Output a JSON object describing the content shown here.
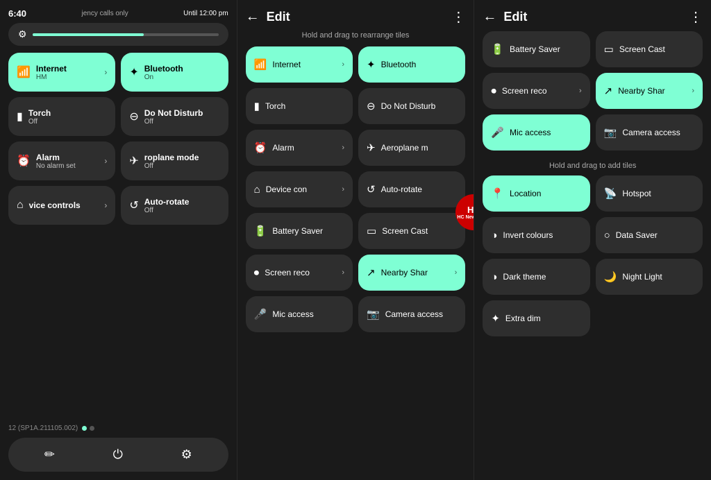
{
  "panel1": {
    "statusBar": {
      "time": "6:40",
      "info": "jency calls only",
      "right": "Until 12:00 pm"
    },
    "brightness": {
      "fill": 60
    },
    "tiles": [
      {
        "id": "internet",
        "label": "Internet",
        "sub": "HM",
        "icon": "📶",
        "active": true,
        "chevron": true
      },
      {
        "id": "bluetooth",
        "label": "Bluetooth",
        "sub": "On",
        "icon": "🔵",
        "active": true,
        "chevron": false
      },
      {
        "id": "torch",
        "label": "Torch",
        "sub": "Off",
        "icon": "🔦",
        "active": false,
        "chevron": false
      },
      {
        "id": "dnd",
        "label": "Do Not Disturb",
        "sub": "Off",
        "icon": "⊖",
        "active": false,
        "chevron": false
      },
      {
        "id": "alarm",
        "label": "Alarm",
        "sub": "No alarm set",
        "icon": "⏰",
        "active": false,
        "chevron": true
      },
      {
        "id": "airplane",
        "label": "roplane mode",
        "sub": "Off",
        "icon": "✈",
        "active": false,
        "chevron": false
      },
      {
        "id": "device",
        "label": "vice controls",
        "sub": "",
        "icon": "🏠",
        "active": false,
        "chevron": true
      },
      {
        "id": "autorotate",
        "label": "Auto-rotate",
        "sub": "Off",
        "icon": "🔄",
        "active": false,
        "chevron": false
      }
    ],
    "buildInfo": "12 (SP1A.211105.002)",
    "bottomBtns": [
      "✏",
      "⏻",
      "⚙"
    ]
  },
  "panel2": {
    "header": {
      "back": "←",
      "title": "Edit",
      "more": "⋮"
    },
    "hint": "Hold and drag to rearrange tiles",
    "tiles": [
      {
        "id": "internet",
        "label": "Internet",
        "icon": "📶",
        "active": true,
        "chevron": true
      },
      {
        "id": "bluetooth",
        "label": "Bluetooth",
        "icon": "🔵",
        "active": true,
        "chevron": false
      },
      {
        "id": "torch",
        "label": "Torch",
        "icon": "🔦",
        "active": false,
        "chevron": false
      },
      {
        "id": "dnd",
        "label": "Do Not Disturb",
        "icon": "⊖",
        "active": false,
        "chevron": false
      },
      {
        "id": "alarm",
        "label": "Alarm",
        "icon": "⏰",
        "active": false,
        "chevron": true
      },
      {
        "id": "airplane",
        "label": "Aeroplane m",
        "icon": "✈",
        "active": false,
        "chevron": false
      },
      {
        "id": "device",
        "label": "Device con",
        "icon": "🏠",
        "active": false,
        "chevron": true
      },
      {
        "id": "autorotate",
        "label": "Auto-rotate",
        "icon": "🔄",
        "active": false,
        "chevron": false
      },
      {
        "id": "battery",
        "label": "Battery Saver",
        "icon": "🔋",
        "active": false,
        "chevron": false
      },
      {
        "id": "screencast",
        "label": "Screen Cast",
        "icon": "📺",
        "active": false,
        "chevron": false
      },
      {
        "id": "screenrec",
        "label": "Screen reco",
        "icon": "⏺",
        "active": false,
        "chevron": true
      },
      {
        "id": "nearby",
        "label": "Nearby Shar",
        "icon": "↗",
        "active": true,
        "chevron": true
      },
      {
        "id": "mic",
        "label": "Mic access",
        "icon": "🎤",
        "active": false,
        "chevron": false
      },
      {
        "id": "camera",
        "label": "Camera access",
        "icon": "📷",
        "active": false,
        "chevron": false
      }
    ]
  },
  "panel3": {
    "header": {
      "back": "←",
      "title": "Edit",
      "more": "⋮"
    },
    "activeTiles": [
      {
        "id": "battery",
        "label": "Battery Saver",
        "icon": "🔋",
        "active": false
      },
      {
        "id": "screencast",
        "label": "Screen Cast",
        "icon": "📺",
        "active": false
      },
      {
        "id": "screenrec",
        "label": "Screen reco",
        "icon": "⏺",
        "active": false,
        "chevron": true
      },
      {
        "id": "nearby",
        "label": "Nearby Shar",
        "icon": "↗",
        "active": true,
        "chevron": true
      },
      {
        "id": "mic",
        "label": "Mic access",
        "icon": "🎤",
        "active": true
      },
      {
        "id": "camera",
        "label": "Camera access",
        "icon": "📷",
        "active": false
      }
    ],
    "addHint": "Hold and drag to add tiles",
    "addTiles": [
      {
        "id": "location",
        "label": "Location",
        "icon": "📍",
        "active": true
      },
      {
        "id": "hotspot",
        "label": "Hotspot",
        "icon": "📡",
        "active": false
      },
      {
        "id": "invert",
        "label": "Invert colours",
        "icon": "◑",
        "active": false
      },
      {
        "id": "datasaver",
        "label": "Data Saver",
        "icon": "○",
        "active": false
      },
      {
        "id": "darktheme",
        "label": "Dark theme",
        "icon": "◑",
        "active": false
      },
      {
        "id": "nightlight",
        "label": "Night Light",
        "icon": "🌙",
        "active": false
      },
      {
        "id": "extradim",
        "label": "Extra dim",
        "icon": "✦",
        "active": false
      }
    ]
  }
}
